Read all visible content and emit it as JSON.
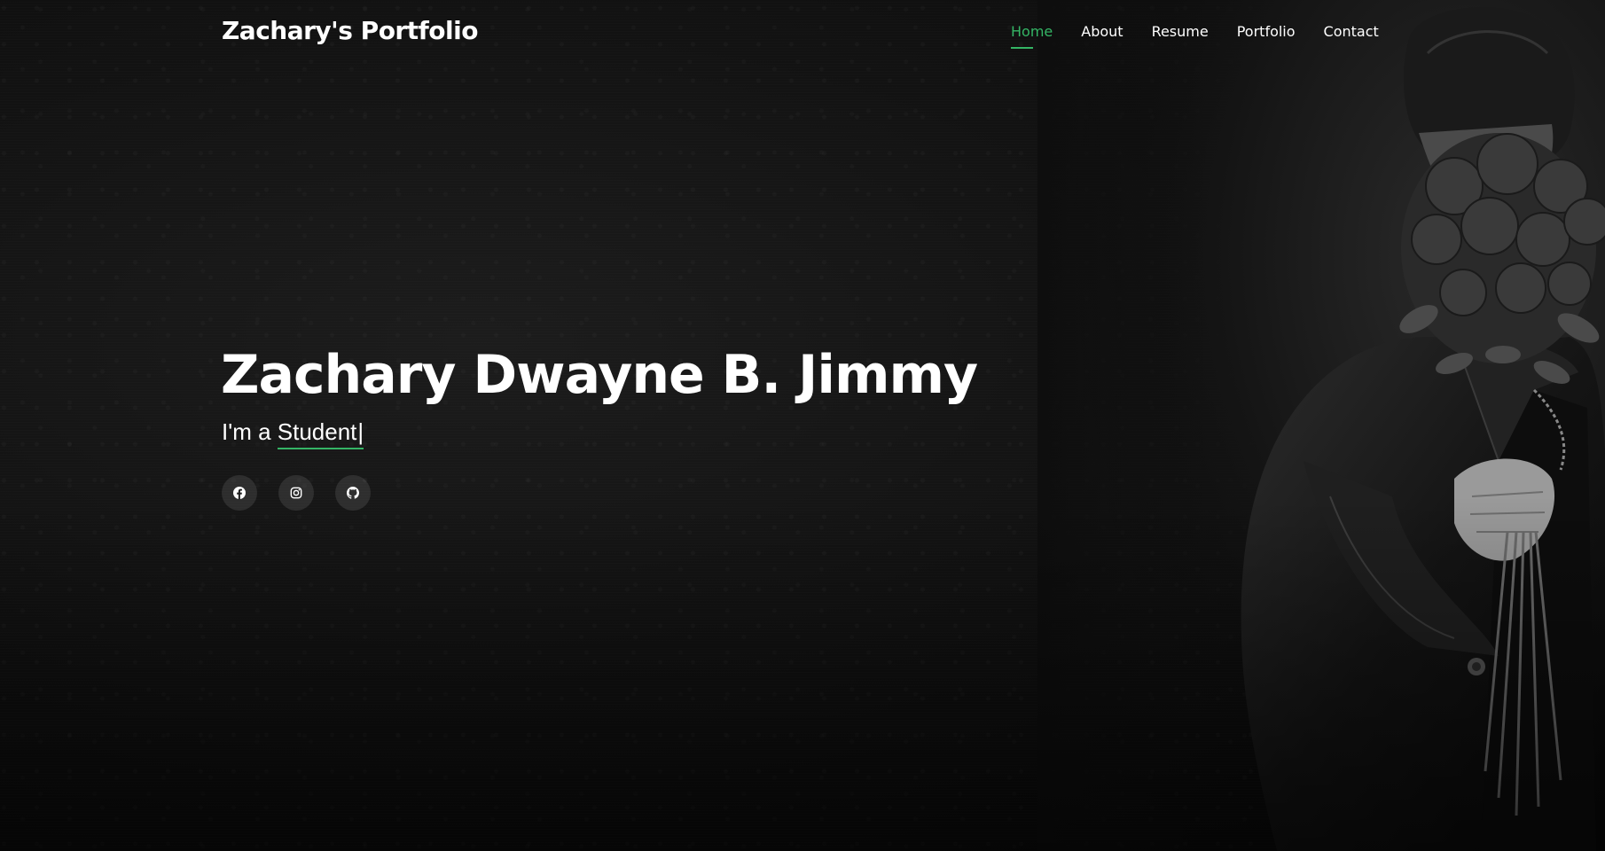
{
  "header": {
    "logo": "Zachary's Portfolio",
    "nav": [
      {
        "label": "Home",
        "active": true
      },
      {
        "label": "About",
        "active": false
      },
      {
        "label": "Resume",
        "active": false
      },
      {
        "label": "Portfolio",
        "active": false
      },
      {
        "label": "Contact",
        "active": false
      }
    ]
  },
  "hero": {
    "name": "Zachary Dwayne B. Jimmy",
    "subtitle_prefix": "I'm a ",
    "typed_word": "Student",
    "cursor": "|",
    "socials": [
      {
        "icon": "facebook-icon"
      },
      {
        "icon": "instagram-icon"
      },
      {
        "icon": "github-icon"
      }
    ]
  },
  "colors": {
    "accent": "#34b565",
    "background": "#0a0a0a",
    "text": "#ffffff"
  }
}
